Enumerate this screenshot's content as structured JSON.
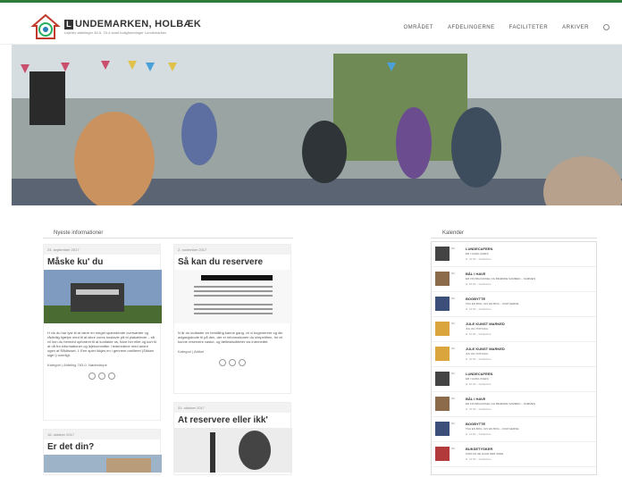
{
  "header": {
    "brand": "UNDEMARKEN, HOLBÆK",
    "brand_initial": "L",
    "tagline": "Lejerbo afdelinger 46-5, 76-4 samt boligforeninger Lundemarken"
  },
  "nav": [
    "OMRÅDET",
    "AFDELINGERNE",
    "FACILITETER",
    "ARKIVER"
  ],
  "sections": {
    "news_heading": "Nyeste informationer",
    "calendar_heading": "Kalender"
  },
  "posts": [
    {
      "date": "24. september 2017",
      "title": "Måske ku' du",
      "excerpt": "H vis du har lyst til at være en meget spændende oversætter og rådtvilig hjælpe med til at sikre vores hustavle på et plakattexte – så vil hun du hermed opfordret til at kontakte os, bare her ellet og kort til at nå fra informationer og lejekommitter i lederedene med andre ogen af Rådhuset. I: Een spier ikkjes en i gennem oreilleret (Sikken sige i) overligt.",
      "meta": "Kategori | Afdeling 763-0, Nødestrupe"
    },
    {
      "date": "2. november 2017",
      "title": "Så kan du reservere",
      "excerpt": "N år du indtaster en bestilling kanne gang, vil vi bogenerere og din adgangskode til på den, der er informationen du simpelthen, for at kunne reservere vaske- og fællesfaciliteter via internettet.",
      "meta": "Kategori | Artikel"
    },
    {
      "date": "16. oktober 2017",
      "title": "Er det din?"
    },
    {
      "date": "31. oktober 2017",
      "title": "At reservere eller ikk'"
    }
  ],
  "calendar": [
    {
      "badge": "NU",
      "title": "LUNDECAFEEN",
      "sub": "ER I GANG (IGEN)",
      "meta": "kl. 16:00 – Fælleshus"
    },
    {
      "badge": "NU",
      "title": "BÅL I HAVE",
      "sub": "ER FIN BÅLFAKKEL OG BRÆNDE SAMMEN – SAMMEN",
      "meta": "kl. 15:00 – Fælleshus"
    },
    {
      "badge": "NU",
      "title": "BOGBYTTE",
      "sub": "TAG EN BOG, GIV EN BOG – KOM GERNE",
      "meta": "kl. 14:00 – Fælleshus"
    },
    {
      "badge": "NU",
      "title": "JULE KUNST MARKED",
      "sub": "JUL OG TOP DAG",
      "meta": "kl. 10:00 – Fælleshus"
    },
    {
      "badge": "NU",
      "title": "JULE KUNST MARKED",
      "sub": "JUL OG TOP DAG",
      "meta": "kl. 10:00 – Fælleshus"
    },
    {
      "badge": "NU",
      "title": "LUNDECAFEEN",
      "sub": "ER I GANG (IGEN)",
      "meta": "kl. 16:00 – Fælleshus"
    },
    {
      "badge": "NU",
      "title": "BÅL I HAVE",
      "sub": "ER FIN BÅLFAKKEL OG BRÆNDE SAMMEN – SAMMEN",
      "meta": "kl. 15:00 – Fælleshus"
    },
    {
      "badge": "NU",
      "title": "BOGBYTTE",
      "sub": "TAG EN BOG, GIV EN BOG – KOM GERNE",
      "meta": "kl. 14:00 – Fælleshus"
    },
    {
      "badge": "NU",
      "title": "BUKSETYSKER",
      "sub": "KOM OG SE HVAD DER SKER",
      "meta": "kl. 12:00 – Fælleshus"
    }
  ]
}
